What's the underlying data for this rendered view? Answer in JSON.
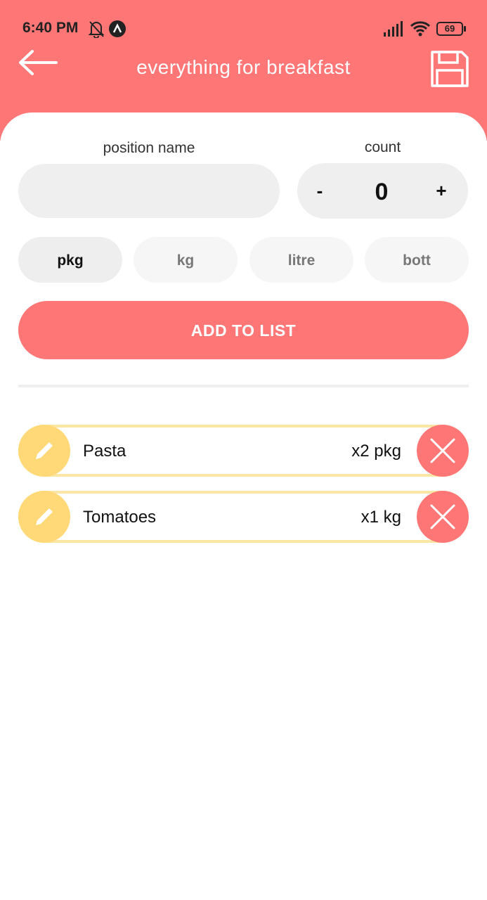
{
  "status_bar": {
    "time": "6:40 PM",
    "battery": "69"
  },
  "header": {
    "title": "everything for breakfast",
    "back_icon": "arrow-left-icon",
    "save_icon": "floppy-disk-icon"
  },
  "form": {
    "name_label": "position name",
    "name_value": "",
    "count_label": "count",
    "count_value": "0",
    "minus_label": "-",
    "plus_label": "+",
    "units": [
      "pkg",
      "kg",
      "litre",
      "bott"
    ],
    "selected_unit": "pkg",
    "add_button": "ADD TO LIST"
  },
  "items": [
    {
      "name": "Pasta",
      "qty": "x2 pkg"
    },
    {
      "name": "Tomatoes",
      "qty": "x1 kg"
    }
  ],
  "colors": {
    "primary": "#ff7676",
    "accent": "#ffd978",
    "item_border": "#fbe7a5",
    "field_bg": "#efefef"
  }
}
